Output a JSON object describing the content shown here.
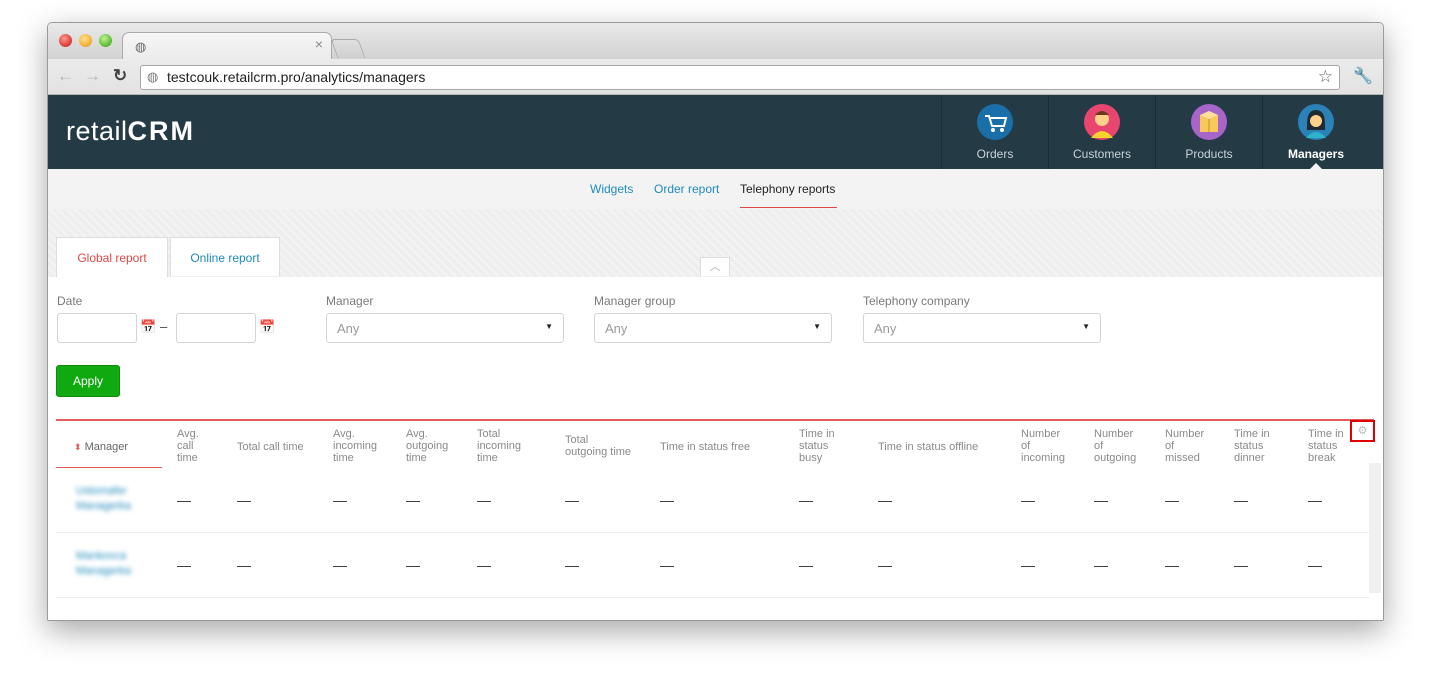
{
  "browser": {
    "url": "testcouk.retailcrm.pro/analytics/managers",
    "tab_close": "×"
  },
  "app": {
    "logo_prefix": "retail",
    "logo_brand": "CRM",
    "nav": [
      {
        "label": "Orders",
        "icon": "cart-icon",
        "color": "#1a6fa8"
      },
      {
        "label": "Customers",
        "icon": "customer-avatar-icon",
        "color": "#e8466e"
      },
      {
        "label": "Products",
        "icon": "product-box-icon",
        "color": "#a764c9"
      },
      {
        "label": "Managers",
        "icon": "manager-avatar-icon",
        "color": "#2a82b8",
        "active": true
      }
    ]
  },
  "subnav": {
    "widgets": "Widgets",
    "order_report": "Order report",
    "telephony_reports": "Telephony reports"
  },
  "report_tabs": {
    "global": "Global report",
    "online": "Online report"
  },
  "filters": {
    "date_label": "Date",
    "date_separator": "–",
    "manager_label": "Manager",
    "manager_value": "Any",
    "group_label": "Manager group",
    "group_value": "Any",
    "telephony_label": "Telephony company",
    "telephony_value": "Any",
    "apply_label": "Apply"
  },
  "table": {
    "sort_indicator": "⬍",
    "columns": [
      "Manager",
      "Avg.\ncall\ntime",
      "Total call time",
      "Avg.\nincoming\ntime",
      "Avg.\noutgoing\ntime",
      "Total\nincoming\ntime",
      "Total\noutgoing time",
      "Time in status free",
      "Time in\nstatus\nbusy",
      "Time in status offline",
      "Number\nof\nincoming",
      "Number\nof\noutgoing",
      "Number\nof\nmissed",
      "Time in\nstatus\ndinner",
      "Time in\nstatus\nbreak"
    ],
    "rows": [
      {
        "manager": "Ustomafer\nManagerka",
        "values": [
          "—",
          "—",
          "—",
          "—",
          "—",
          "—",
          "—",
          "—",
          "—",
          "—",
          "—",
          "—",
          "—",
          "—"
        ]
      },
      {
        "manager": "Mankovca\nManagerka",
        "values": [
          "—",
          "—",
          "—",
          "—",
          "—",
          "—",
          "—",
          "—",
          "—",
          "—",
          "—",
          "—",
          "—",
          "—"
        ]
      }
    ]
  }
}
